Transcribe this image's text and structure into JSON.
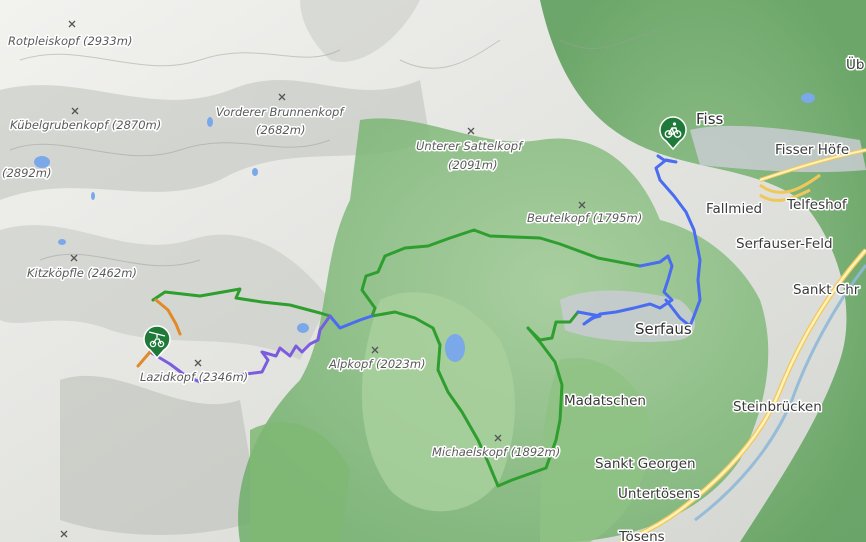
{
  "map": {
    "peaks": [
      {
        "name": "Rotpleiskopf (2933m)"
      },
      {
        "name": "Kübelgrubenkopf (2870m)"
      },
      {
        "name": "(2892m)"
      },
      {
        "name": "Kitzköpfle (2462m)"
      },
      {
        "name": "Vorderer Brunnenkopf"
      },
      {
        "name": "(2682m)"
      },
      {
        "name": "Unterer Sattelkopf"
      },
      {
        "name": "(2091m)"
      },
      {
        "name": "Beutelkopf (1795m)"
      },
      {
        "name": "Alpkopf (2023m)"
      },
      {
        "name": "Lazidkopf (2346m)"
      },
      {
        "name": "Michaelskopf (1892m)"
      }
    ],
    "places": [
      {
        "name": "Fiss"
      },
      {
        "name": "Fisser Höfe"
      },
      {
        "name": "Fallmied"
      },
      {
        "name": "Telfeshof"
      },
      {
        "name": "Serfauser-Feld"
      },
      {
        "name": "Serfaus"
      },
      {
        "name": "Sankt Chr"
      },
      {
        "name": "Madatschen"
      },
      {
        "name": "Steinbrücken"
      },
      {
        "name": "Sankt Georgen"
      },
      {
        "name": "Untertösens"
      },
      {
        "name": "Tösens"
      },
      {
        "name": "Üb"
      }
    ],
    "markers": [
      {
        "icon": "bike-icon",
        "color": "#1f7a3a"
      },
      {
        "icon": "bike-lift-icon",
        "color": "#1f7a3a"
      }
    ],
    "routes": [
      {
        "name": "green-trail",
        "color": "#2e9e2e"
      },
      {
        "name": "blue-trail",
        "color": "#4a6cf0"
      },
      {
        "name": "purple-trail",
        "color": "#7b5ce0"
      },
      {
        "name": "orange-trail",
        "color": "#e08a2a"
      }
    ]
  }
}
